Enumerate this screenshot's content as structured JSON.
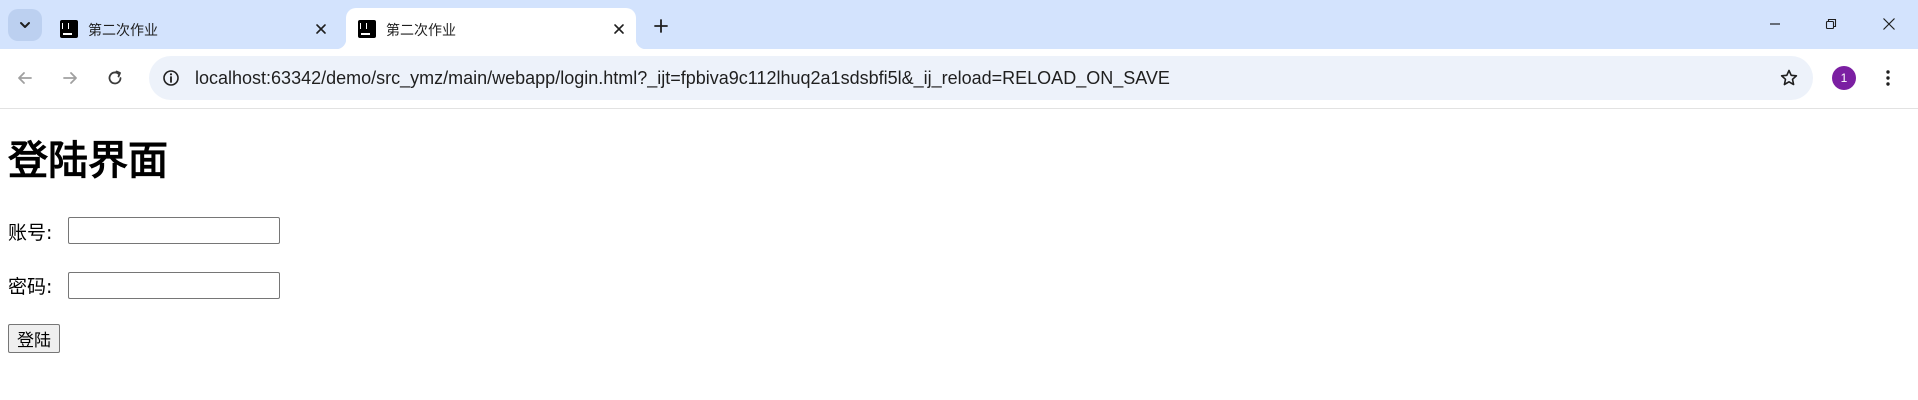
{
  "browser": {
    "tabs": [
      {
        "title": "第二次作业",
        "active": false
      },
      {
        "title": "第二次作业",
        "active": true
      }
    ],
    "url": "localhost:63342/demo/src_ymz/main/webapp/login.html?_ijt=fpbiva9c112lhuq2a1sdsbfi5l&_ij_reload=RELOAD_ON_SAVE",
    "profile_initial": "1",
    "icons": [
      "tab-search-icon",
      "favicon-icon",
      "close-icon",
      "plus-icon",
      "minimize-icon",
      "restore-icon",
      "window-close-icon",
      "back-arrow-icon",
      "forward-arrow-icon",
      "reload-icon",
      "site-info-icon",
      "bookmark-star-icon",
      "kebab-menu-icon"
    ],
    "colors": {
      "tabstrip": "#d3e3fd",
      "omnibox": "#edf2fa",
      "profile": "#7b1fa2"
    }
  },
  "page": {
    "heading": "登陆界面",
    "account_label": "账号:",
    "account_value": "",
    "password_label": "密码:",
    "password_value": "",
    "login_button": "登陆"
  }
}
